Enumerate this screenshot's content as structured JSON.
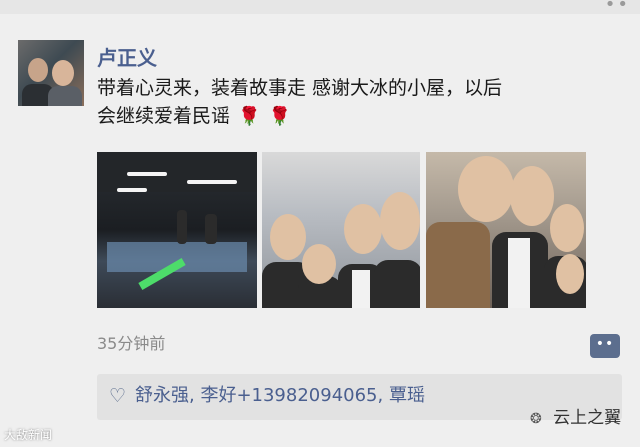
{
  "post": {
    "username": "卢正义",
    "text": "带着心灵来，装着故事走   感谢大冰的小屋，以后\n会继续爱着民谣",
    "emoji": [
      "🌹",
      "🌹"
    ],
    "photos": [
      {
        "name": "concert-venue-photo"
      },
      {
        "name": "group-selfie-photo-1"
      },
      {
        "name": "group-selfie-photo-2"
      }
    ],
    "time": "35分钟前",
    "likes": "舒永强, 李好+13982094065, 覃瑶"
  },
  "icons": {
    "like": "heart-outline-icon",
    "comment": "more-dots-icon"
  },
  "watermarks": {
    "left": "大敌新闻",
    "right": "云上之翼"
  },
  "colors": {
    "accent": "#5c6e8e",
    "name": "#4a5f8f"
  }
}
